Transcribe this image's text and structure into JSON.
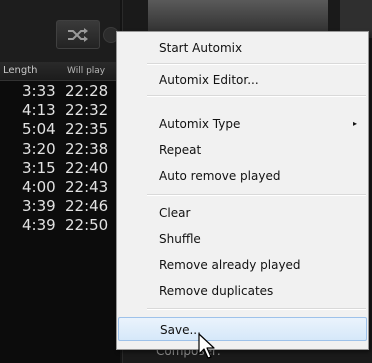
{
  "playlist": {
    "header": {
      "length": "Length",
      "will_play": "Will play"
    },
    "rows": [
      {
        "length": "3:33",
        "will_play": "22:28"
      },
      {
        "length": "4:13",
        "will_play": "22:32"
      },
      {
        "length": "5:04",
        "will_play": "22:35"
      },
      {
        "length": "3:20",
        "will_play": "22:38"
      },
      {
        "length": "3:15",
        "will_play": "22:40"
      },
      {
        "length": "4:00",
        "will_play": "22:43"
      },
      {
        "length": "3:39",
        "will_play": "22:46"
      },
      {
        "length": "4:39",
        "will_play": "22:50"
      }
    ]
  },
  "toolbar": {
    "shuffle_icon": "shuffle-icon"
  },
  "menu": {
    "items": [
      {
        "label": "Start Automix"
      },
      {
        "label": "Automix Editor..."
      },
      {
        "label": "Automix Type",
        "submenu": true
      },
      {
        "label": "Repeat"
      },
      {
        "label": "Auto remove played"
      },
      {
        "label": "Clear"
      },
      {
        "label": "Shuffle"
      },
      {
        "label": "Remove already played"
      },
      {
        "label": "Remove duplicates"
      },
      {
        "label": "Save...",
        "highlighted": true
      }
    ],
    "submenu_arrow": "▸"
  },
  "details": {
    "composer_label": "Composer:"
  }
}
